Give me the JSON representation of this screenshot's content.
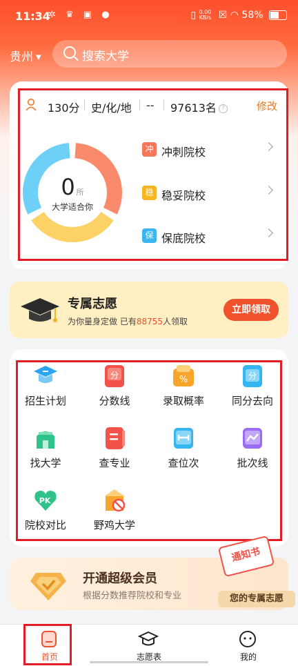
{
  "status_bar": {
    "time": "11:34",
    "net_speed_value": "0.00",
    "net_speed_unit": "KB/s",
    "battery": "58%",
    "battery_level": 0.58
  },
  "header": {
    "region": "贵州",
    "search_placeholder": "搜索大学"
  },
  "score_card": {
    "score": "130分",
    "subjects": "史/化/地",
    "extra": "--",
    "rank": "97613名",
    "edit_label": "修改",
    "donut": {
      "count": "0",
      "unit": "所",
      "caption": "大学适合你",
      "segments": [
        {
          "name": "冲",
          "color": "#f98a6c"
        },
        {
          "name": "稳",
          "color": "#fcd266"
        },
        {
          "name": "保",
          "color": "#6fd0f7"
        }
      ]
    },
    "tiers": [
      {
        "badge": "冲",
        "label": "冲刺院校",
        "color": "#f4775a"
      },
      {
        "badge": "稳",
        "label": "稳妥院校",
        "color": "#f5b520"
      },
      {
        "badge": "保",
        "label": "保底院校",
        "color": "#3cb6ee"
      }
    ]
  },
  "promo": {
    "title": "专属志愿",
    "sub_prefix": "为你量身定做  已有",
    "count": "88755",
    "sub_suffix": "人领取",
    "cta": "立即领取"
  },
  "tools": [
    {
      "label": "招生计划",
      "icon": "graduation-cap-icon"
    },
    {
      "label": "分数线",
      "icon": "score-icon"
    },
    {
      "label": "录取概率",
      "icon": "percent-icon"
    },
    {
      "label": "同分去向",
      "icon": "same-score-icon"
    },
    {
      "label": "找大学",
      "icon": "university-icon"
    },
    {
      "label": "查专业",
      "icon": "major-icon"
    },
    {
      "label": "查位次",
      "icon": "rank-icon"
    },
    {
      "label": "批次线",
      "icon": "batch-line-icon"
    },
    {
      "label": "院校对比",
      "icon": "pk-icon"
    },
    {
      "label": "野鸡大学",
      "icon": "fake-university-icon"
    }
  ],
  "member": {
    "title": "开通超级会员",
    "sub": "根据分数推荐院校和专业",
    "notice": "通知书",
    "tag": "您的专属志愿"
  },
  "tabbar": [
    {
      "label": "首页",
      "icon": "home-icon",
      "active": true
    },
    {
      "label": "志愿表",
      "icon": "graduation-cap-icon",
      "active": false
    },
    {
      "label": "我的",
      "icon": "profile-face-icon",
      "active": false
    }
  ]
}
